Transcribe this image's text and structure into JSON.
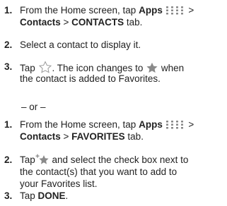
{
  "section_a": {
    "step1": {
      "num": "1.",
      "line1_pre": "From the Home screen, tap ",
      "apps": "Apps",
      "line1_post": " >",
      "contacts": "Contacts",
      "sep": " > ",
      "tab_name": "CONTACTS",
      "tab_suffix": " tab."
    },
    "step2": {
      "num": "2.",
      "text": "Select a contact to display it."
    },
    "step3": {
      "num": "3.",
      "pre": "Tap ",
      "mid": ". The icon changes to ",
      "post": " when",
      "line2": "the contact is added to Favorites."
    }
  },
  "or_text": "– or –",
  "section_b": {
    "step1": {
      "num": "1.",
      "line1_pre": "From the Home screen, tap ",
      "apps": "Apps",
      "line1_post": " >",
      "contacts": "Contacts",
      "sep": " > ",
      "tab_name": "FAVORITES",
      "tab_suffix": " tab."
    },
    "step2": {
      "num": "2.",
      "pre": "Tap",
      "line1_post": " and select the check box next to",
      "line2": "the contact(s) that you want to add to",
      "line3": "your Favorites list."
    },
    "step3": {
      "num": "3.",
      "pre": "Tap ",
      "done": "DONE",
      "post": "."
    }
  },
  "icons": {
    "apps": "apps-grid-icon",
    "star_outline": "star-outline-icon",
    "star_filled": "star-filled-icon",
    "add_favorite": "add-favorite-icon"
  },
  "colors": {
    "text": "#222222",
    "icon_gray": "#8a8a8a",
    "star_outline": "#9a9a9a"
  }
}
